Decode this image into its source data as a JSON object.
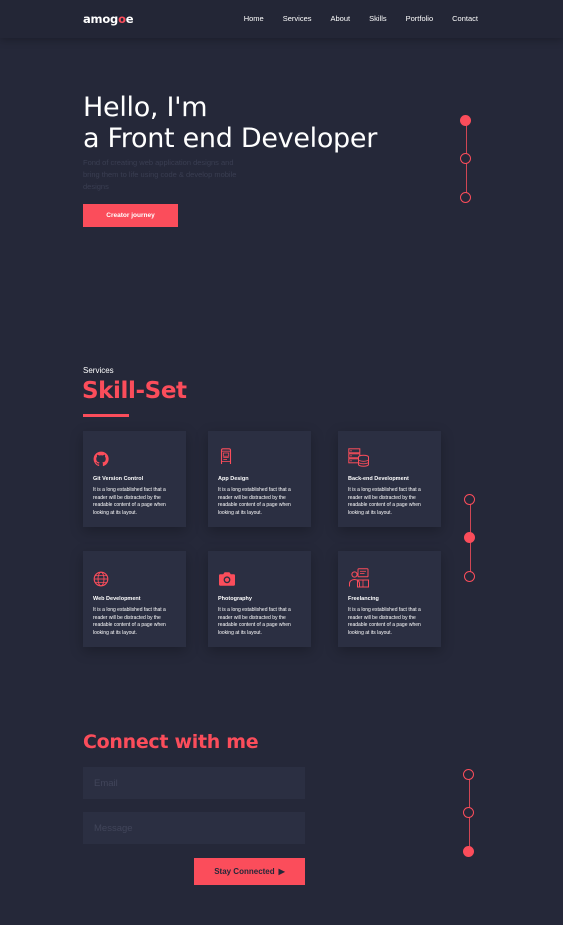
{
  "nav": {
    "logo_main": "amog",
    "logo_accent": "o",
    "logo_tail": "e",
    "links": [
      "Home",
      "Services",
      "About",
      "Skills",
      "Portfolio",
      "Contact"
    ]
  },
  "hero": {
    "title_line1": "Hello, I'm",
    "title_line2": "a Front end Developer",
    "description": "Fond of creating web application designs and bring them to life using code & develop mobile designs",
    "cta_label": "Creator journey"
  },
  "services": {
    "kicker": "Services",
    "title": "Skill-Set",
    "cards": [
      {
        "title": "Git Version Control",
        "text": "It is a long established fact that a reader will be distracted by the readable content of a page when looking at its layout.",
        "icon": "github-icon"
      },
      {
        "title": "App Design",
        "text": "It is a long established fact that a reader will be distracted by the readable content of a page when looking at its layout.",
        "icon": "mobile-app-icon"
      },
      {
        "title": "Back-end Development",
        "text": "It is a long established fact that a reader will be distracted by the readable content of a page when looking at its layout.",
        "icon": "server-database-icon"
      },
      {
        "title": "Web Development",
        "text": "It is a long established fact that a reader will be distracted by the readable content of a page when looking at its layout.",
        "icon": "globe-icon"
      },
      {
        "title": "Photography",
        "text": "It is a long established fact that a reader will be distracted by the readable content of a page when looking at its layout.",
        "icon": "camera-icon"
      },
      {
        "title": "Freelancing",
        "text": "It is a long established fact that a reader will be distracted by the readable content of a page when looking at its layout.",
        "icon": "freelancer-icon"
      }
    ]
  },
  "contact": {
    "title": "Connect with me",
    "email_placeholder": "Email",
    "message_placeholder": "Message",
    "submit_label": "Stay Connected"
  },
  "colors": {
    "background": "#252839",
    "card": "#2b2f42",
    "accent": "#fb4d5b"
  }
}
